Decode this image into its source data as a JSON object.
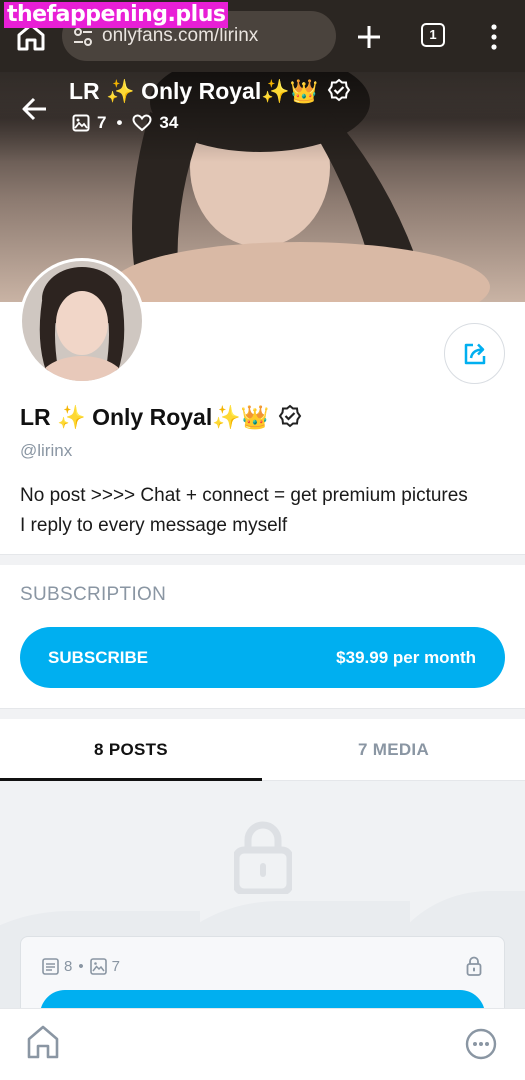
{
  "browser": {
    "watermark": "thefappening.plus",
    "url": "onlyfans.com/lirinx",
    "tab_count": "1",
    "icons": [
      "home-icon",
      "site-settings-icon",
      "plus-icon",
      "tabs-icon",
      "overflow-menu-icon"
    ]
  },
  "cover": {
    "name": "LR ✨ Only Royal✨👑",
    "images_count": "7",
    "likes_count": "34",
    "icons": [
      "back-arrow-icon",
      "image-icon",
      "heart-icon",
      "verified-icon"
    ]
  },
  "profile": {
    "name": "LR ✨ Only Royal✨👑",
    "handle": "@lirinx",
    "bio_line1": "No post >>>> Chat + connect = get premium pictures",
    "bio_line2": "I reply to every message myself"
  },
  "subscription": {
    "label": "SUBSCRIPTION",
    "button_label": "SUBSCRIBE",
    "price": "$39.99 per month"
  },
  "tabs": {
    "posts": "8 POSTS",
    "media": "7 MEDIA"
  },
  "locked": {
    "posts_count": "8",
    "media_count": "7"
  },
  "colors": {
    "accent": "#00aff0",
    "browser_bar": "#2b2622",
    "muted_text": "#8a96a3",
    "watermark": "#e81fd6"
  }
}
